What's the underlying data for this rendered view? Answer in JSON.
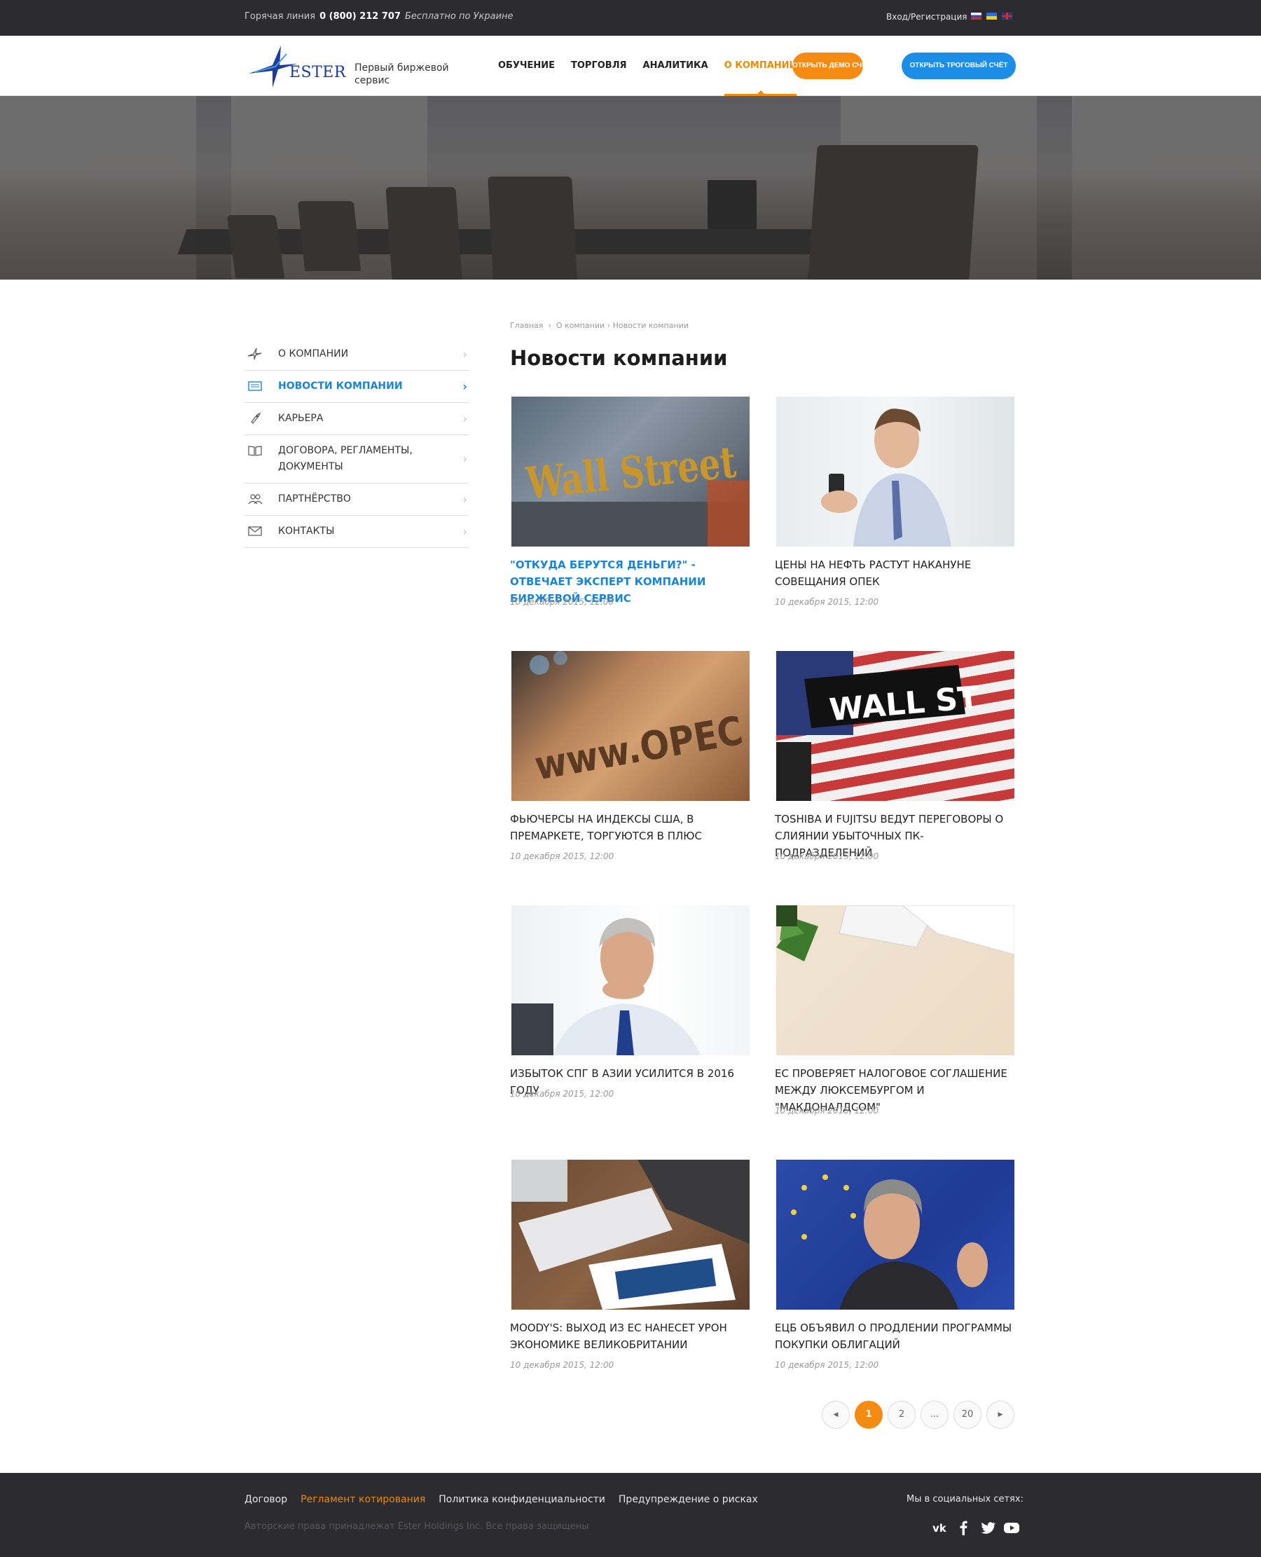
{
  "topbar": {
    "hotline_label": "Горячая линия",
    "hotline_number": "0 (800) 212 707",
    "hotline_note": "Бесплатно по Украине",
    "login": "Вход/Регистрация",
    "languages": [
      "ru",
      "ua",
      "en"
    ]
  },
  "header": {
    "logo_text": "ESTER",
    "tagline": "Первый биржевой сервис",
    "nav": [
      "ОБУЧЕНИЕ",
      "ТОРГОВЛЯ",
      "АНАЛИТИКА",
      "О КОМПАНИИ"
    ],
    "active_nav": "О КОМПАНИИ",
    "btn_demo": "ОТКРЫТЬ ДЕМО СЧЁТ",
    "btn_real": "ОТКРЫТЬ ТРОГОВЫЙ СЧЁТ",
    "accent": "#f68b13",
    "blue": "#1c8ee8"
  },
  "breadcrumb": [
    "Главная",
    "О компании",
    "Новости компании"
  ],
  "page_title": "Новости компании",
  "sidebar": {
    "items": [
      {
        "label": "О КОМПАНИИ",
        "icon": "star-logo-icon"
      },
      {
        "label": "НОВОСТИ КОМПАНИИ",
        "icon": "newspaper-icon",
        "active": true
      },
      {
        "label": "КАРЬЕРА",
        "icon": "rocket-icon"
      },
      {
        "label": "ДОГОВОРА, РЕГЛАМЕНТЫ, ДОКУМЕНТЫ",
        "icon": "book-icon"
      },
      {
        "label": "ПАРТНЁРСТВО",
        "icon": "people-icon"
      },
      {
        "label": "КОНТАКТЫ",
        "icon": "envelope-icon"
      }
    ]
  },
  "news": [
    {
      "title": "\"ОТКУДА БЕРУТСЯ ДЕНЬГИ?\" - ОТВЕЧАЕТ ЭКСПЕРТ КОМПАНИИ БИРЖЕВОЙ СЕРВИС",
      "date": "10 декабря 2015, 12:00",
      "image": "wall-street-sign",
      "image_text": "Wall Street"
    },
    {
      "title": "ЦЕНЫ НА НЕФТЬ РАСТУТ НАКАНУНЕ СОВЕЩАНИЯ ОПЕК",
      "date": "10 декабря 2015, 12:00",
      "image": "man-with-phone"
    },
    {
      "title": "ФЬЮЧЕРСЫ НА ИНДЕКСЫ США, В ПРЕМАРКЕТЕ, ТОРГУЮТСЯ В ПЛЮС",
      "date": "10 декабря 2015, 12:00",
      "image": "opec-sign",
      "image_text": "www.OPEC"
    },
    {
      "title": "TOSHIBA И FUJITSU ВЕДУТ ПЕРЕГОВОРЫ О СЛИЯНИИ УБЫТОЧНЫХ ПК-ПОДРАЗДЕЛЕНИЙ",
      "date": "10 декабря 2015, 12:00",
      "image": "wall-st-street-sign",
      "image_text": "WALL ST"
    },
    {
      "title": "ИЗБЫТОК СПГ В АЗИИ УСИЛИТСЯ В 2016 ГОДУ",
      "date": "10 декабря 2015, 12:00",
      "image": "thinking-businessman"
    },
    {
      "title": "ЕС ПРОВЕРЯЕТ НАЛОГОВОЕ СОГЛАШЕНИЕ МЕЖДУ ЛЮКСЕМБУРГОМ И \"МАКДОНАЛДСОМ\"",
      "date": "10 декабря 2015, 12:00",
      "image": "desk-keyboard-plant"
    },
    {
      "title": "MOODY'S: ВЫХОД ИЗ ЕС НАНЕСЕТ УРОН ЭКОНОМИКЕ ВЕЛИКОБРИТАНИИ",
      "date": "10 декабря 2015, 12:00",
      "image": "laptop-tablet"
    },
    {
      "title": "ЕЦБ ОБЪЯВИЛ О ПРОДЛЕНИИ ПРОГРАММЫ ПОКУПКИ ОБЛИГАЦИЙ",
      "date": "10 декабря 2015, 12:00",
      "image": "eu-speaker"
    }
  ],
  "pagination": {
    "prev": "◀",
    "pages": [
      "1",
      "2",
      "...",
      "20"
    ],
    "current": "1",
    "next": "▶"
  },
  "footer": {
    "links": [
      "Договор",
      "Регламент котирования",
      "Политика конфиденциальности",
      "Предупреждение о рисках"
    ],
    "highlighted_link": "Регламент котирования",
    "copyright": "Авторские права принадлежат Ester Holdings Inc. Все права защищены",
    "social_label": "Мы в социальных сетях:",
    "social": [
      "vk-icon",
      "facebook-icon",
      "twitter-icon",
      "youtube-icon"
    ]
  }
}
